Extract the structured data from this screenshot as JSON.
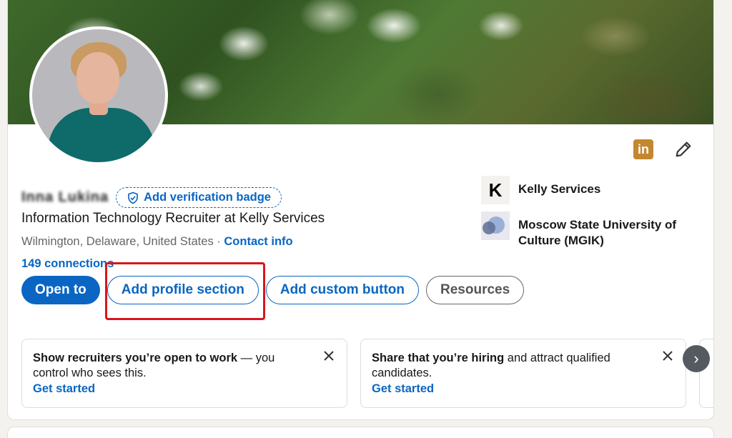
{
  "profile": {
    "name": "Inna Lukina",
    "verification_badge": "Add verification badge",
    "headline": "Information Technology Recruiter at Kelly Services",
    "location": "Wilmington, Delaware, United States",
    "separator": "·",
    "contact_info": "Contact info",
    "connections": "149 connections"
  },
  "top_icons": {
    "linkedin_label": "in"
  },
  "orgs": [
    {
      "logo": "K",
      "name": "Kelly Services"
    },
    {
      "logo": "",
      "name": "Moscow State University of Culture (MGIK)"
    }
  ],
  "buttons": {
    "open_to": "Open to",
    "add_profile_section": "Add profile section",
    "add_custom_button": "Add custom button",
    "resources": "Resources"
  },
  "panels": [
    {
      "bold": "Show recruiters you’re open to work",
      "text": " — you control who sees this.",
      "link": "Get started"
    },
    {
      "bold": "Share that you’re hiring",
      "text": " and attract qualified candidates.",
      "link": "Get started"
    }
  ],
  "colors": {
    "brand_blue": "#0a66c2",
    "highlight_red": "#d9151d",
    "linkedin_icon": "#c4872f"
  },
  "icons": {
    "next": "›"
  }
}
